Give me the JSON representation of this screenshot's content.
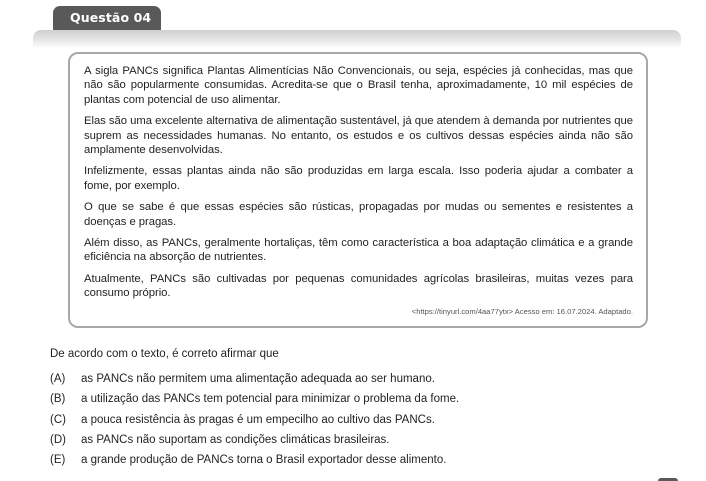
{
  "header": {
    "tab_label": "Questão 04"
  },
  "text": {
    "paragraphs": [
      "A sigla PANCs significa Plantas Alimentícias Não Convencionais, ou seja, espécies já conhecidas, mas que não são popularmente consumidas. Acredita-se que o Brasil tenha, aproximadamente, 10 mil espécies de plantas com potencial de uso alimentar.",
      "Elas são uma excelente alternativa de alimentação sustentável, já que atendem à demanda por nutrientes que suprem as necessidades humanas. No entanto, os estudos e os cultivos dessas espécies ainda não são amplamente desenvolvidas.",
      "Infelizmente, essas plantas ainda não são produzidas em larga escala. Isso poderia ajudar a combater a fome, por exemplo.",
      "O que se sabe é que essas espécies são rústicas, propagadas por mudas ou sementes e resistentes a doenças e pragas.",
      "Além disso, as PANCs, geralmente hortaliças, têm como característica a boa adaptação climática e a grande eficiência na absorção de nutrientes.",
      "Atualmente, PANCs são cultivadas por pequenas comunidades agrícolas brasileiras, muitas vezes para consumo próprio."
    ],
    "source": "<https://tinyurl.com/4aa77ytx> Acesso em: 16.07.2024. Adaptado."
  },
  "question": {
    "prompt": "De acordo com o texto, é correto afirmar que",
    "options": [
      {
        "letter": "(A)",
        "text": "as PANCs não permitem uma alimentação adequada ao ser humano."
      },
      {
        "letter": "(B)",
        "text": "a utilização das PANCs tem potencial para minimizar o problema da fome."
      },
      {
        "letter": "(C)",
        "text": "a pouca resistência às pragas é um empecilho ao cultivo das PANCs."
      },
      {
        "letter": "(D)",
        "text": "as PANCs não suportam as condições climáticas brasileiras."
      },
      {
        "letter": "(E)",
        "text": "a grande produção de PANCs torna o Brasil exportador desse alimento."
      }
    ]
  }
}
